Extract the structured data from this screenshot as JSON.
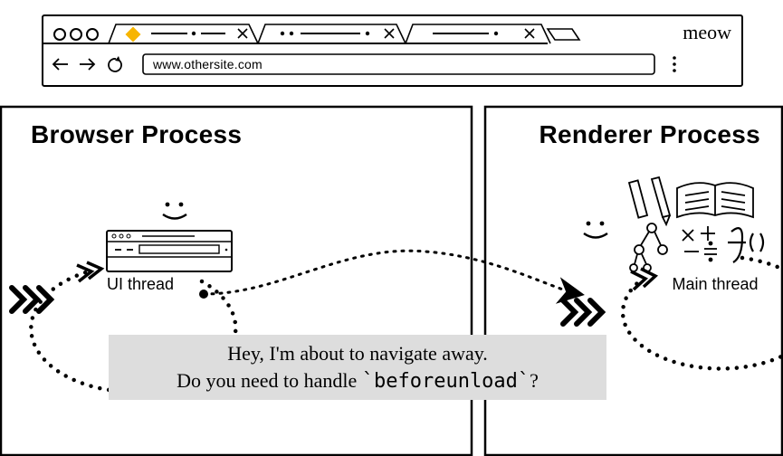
{
  "doc": {
    "brand": "meow",
    "url": "www.othersite.com"
  },
  "panels": {
    "browser_title": "Browser Process",
    "renderer_title": "Renderer Process",
    "ui_thread_label": "UI thread",
    "main_thread_label": "Main thread"
  },
  "message": {
    "line1": "Hey, I'm about to navigate away.",
    "line2_a": "Do you need to handle ",
    "line2_code": "`beforeunload`",
    "line2_b": "?"
  }
}
